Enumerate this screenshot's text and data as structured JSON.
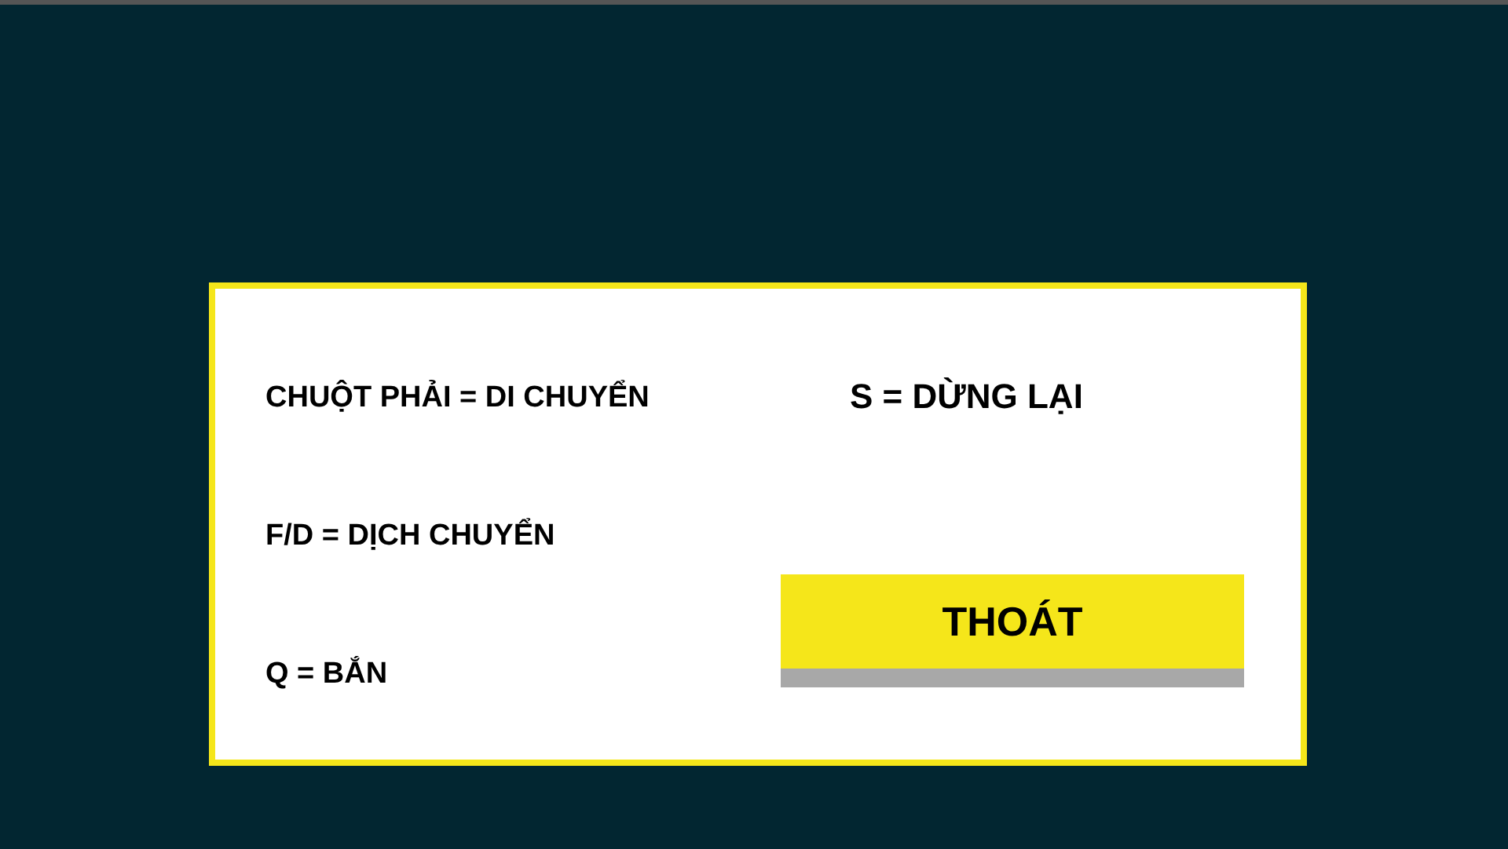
{
  "hints": [
    "CHUỘT PHẢI = DI CHUYỂN",
    "F/D = DỊCH CHUYỂN",
    "Q = BẮN"
  ],
  "stop_hint": "S = DỪNG LẠI",
  "exit_button": {
    "label": "THOÁT"
  }
}
